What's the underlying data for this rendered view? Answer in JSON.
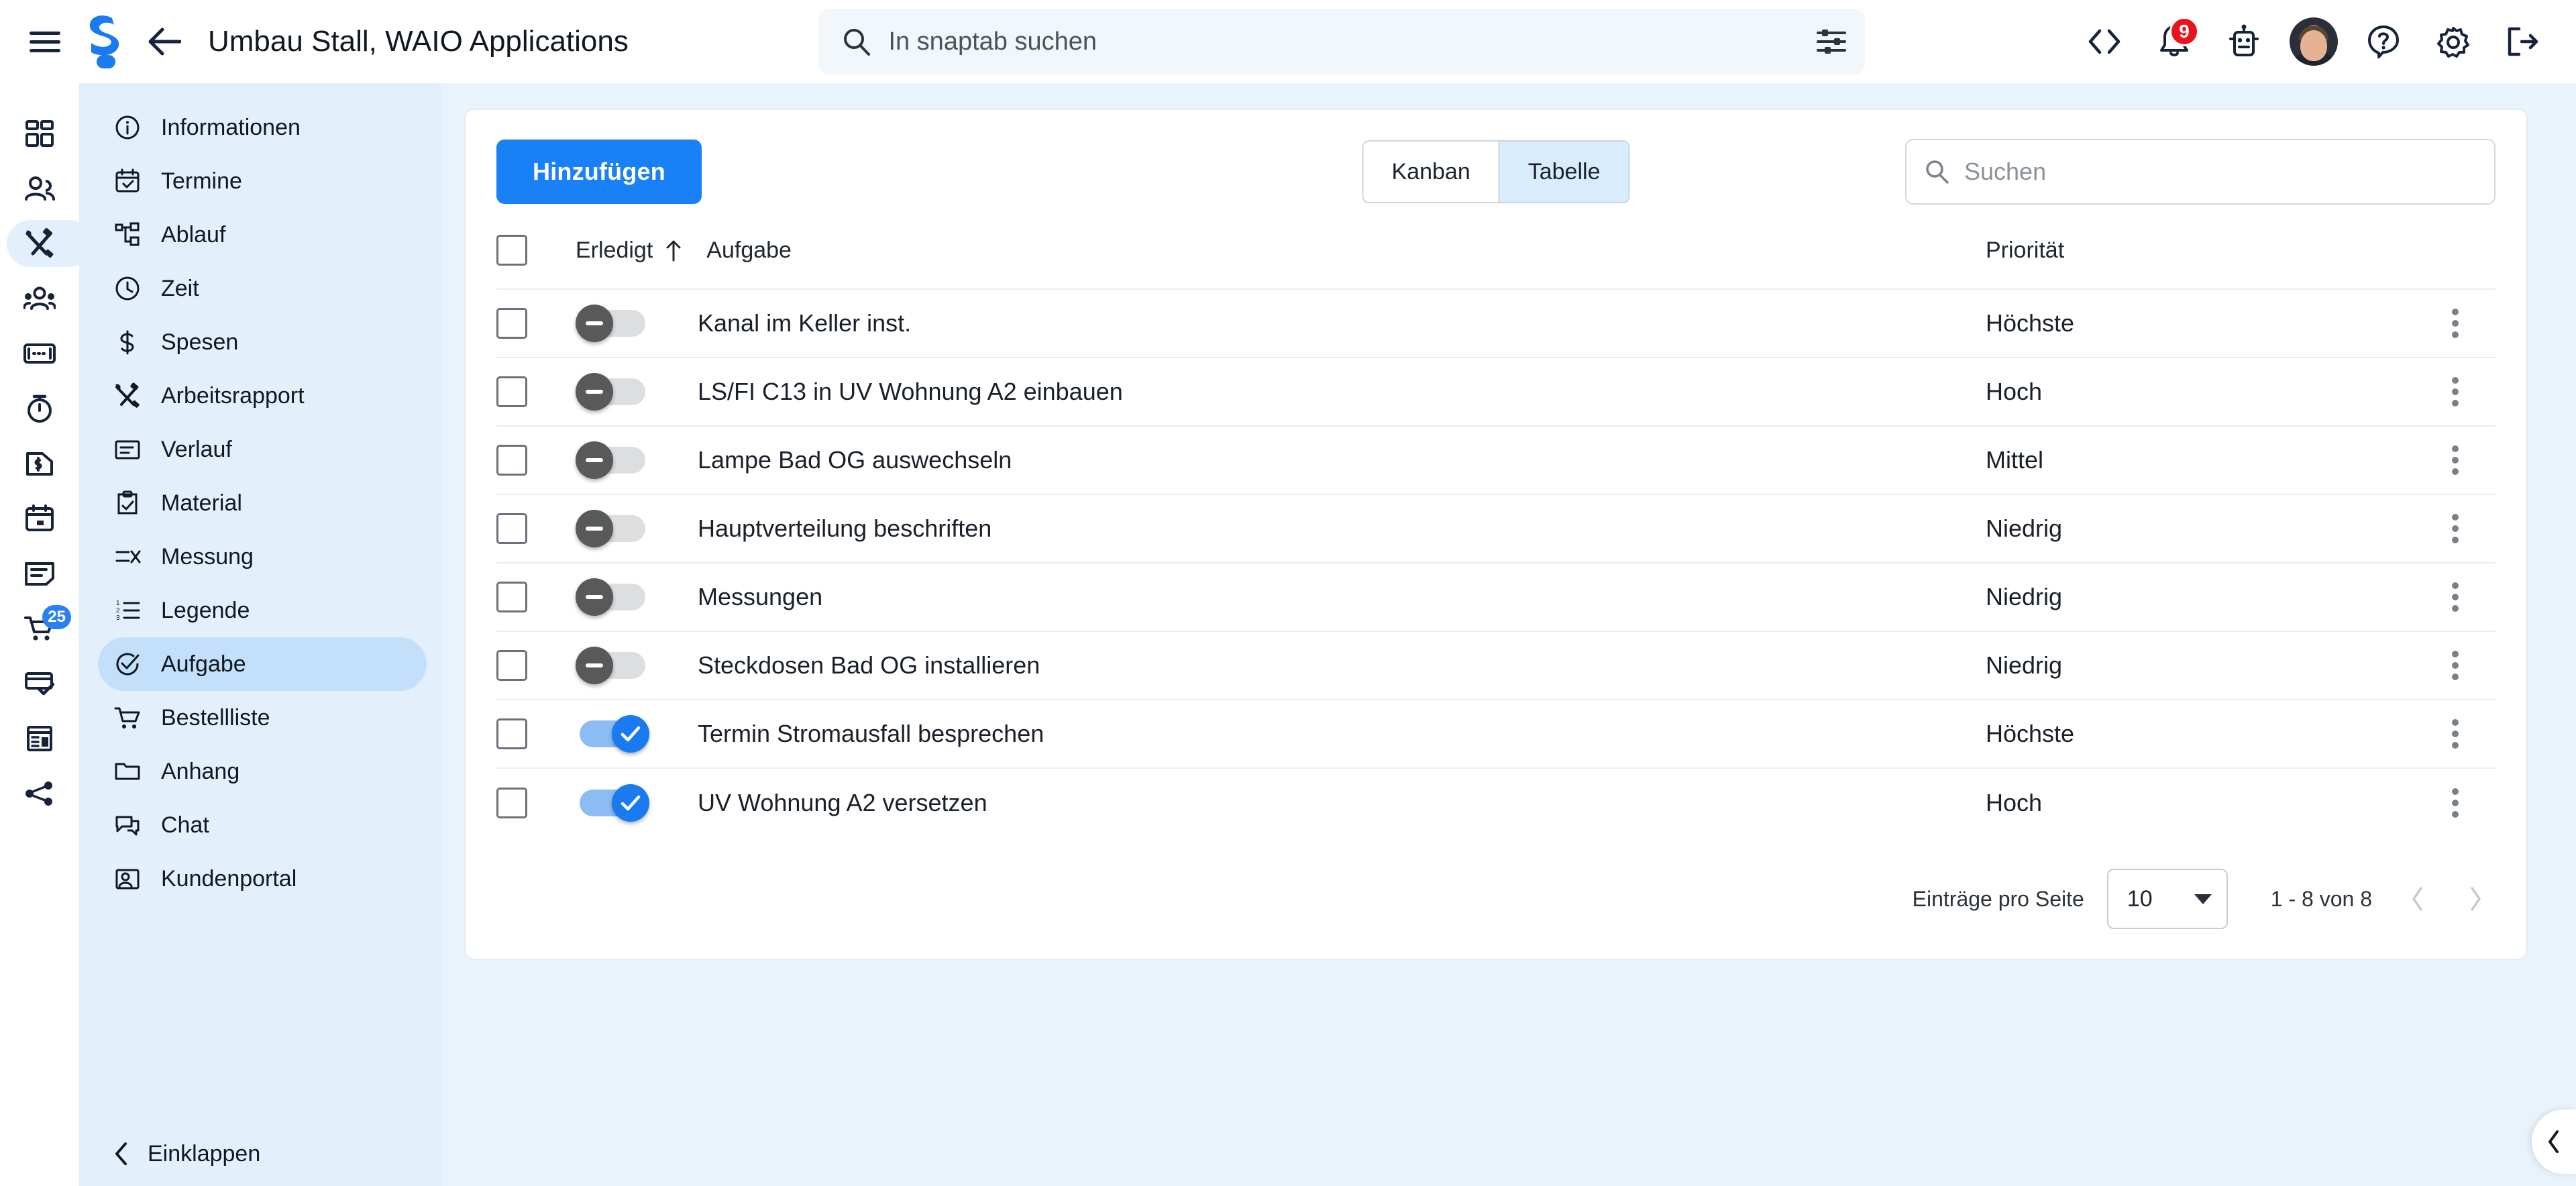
{
  "topbar": {
    "menu_icon": "hamburger-menu-icon",
    "logo_icon": "snaptab-logo-icon",
    "back_icon": "arrow-left-icon",
    "title": "Umbau Stall, WAIO Applications",
    "search": {
      "placeholder": "In snaptab suchen",
      "value": "",
      "search_icon": "search-icon",
      "filter_icon": "tune-filter-icon"
    },
    "actions": [
      {
        "name": "code-brackets-icon",
        "label": ""
      },
      {
        "name": "notification-bell-icon",
        "label": "",
        "badge": "9"
      },
      {
        "name": "robot-assistant-icon",
        "label": ""
      },
      {
        "name": "user-avatar",
        "label": ""
      },
      {
        "name": "help-question-icon",
        "label": ""
      },
      {
        "name": "settings-gear-icon",
        "label": ""
      },
      {
        "name": "logout-icon",
        "label": ""
      }
    ],
    "badge_count": "9"
  },
  "rail": {
    "items": [
      {
        "name": "dashboard-grid-icon",
        "active": false
      },
      {
        "name": "contacts-people-icon",
        "active": false
      },
      {
        "name": "tools-wrench-hammer-icon",
        "active": true
      },
      {
        "name": "team-group-icon",
        "active": false
      },
      {
        "name": "card-id-icon",
        "active": false
      },
      {
        "name": "stopwatch-icon",
        "active": false
      },
      {
        "name": "invoice-money-icon",
        "active": false
      },
      {
        "name": "calendar-icon",
        "active": false
      },
      {
        "name": "note-document-icon",
        "active": false
      },
      {
        "name": "shopping-cart-icon",
        "active": false,
        "badge": "25"
      },
      {
        "name": "card-check-icon",
        "active": false
      },
      {
        "name": "receipt-building-icon",
        "active": false
      },
      {
        "name": "share-network-icon",
        "active": false
      }
    ]
  },
  "sidebar": {
    "items": [
      {
        "label": "Informationen",
        "icon": "info-circle-icon",
        "active": false
      },
      {
        "label": "Termine",
        "icon": "calendar-check-icon",
        "active": false
      },
      {
        "label": "Ablauf",
        "icon": "workflow-tree-icon",
        "active": false
      },
      {
        "label": "Zeit",
        "icon": "clock-icon",
        "active": false
      },
      {
        "label": "Spesen",
        "icon": "dollar-sign-icon",
        "active": false
      },
      {
        "label": "Arbeitsrapport",
        "icon": "tools-wrench-hammer-icon",
        "active": false
      },
      {
        "label": "Verlauf",
        "icon": "history-card-icon",
        "active": false
      },
      {
        "label": "Material",
        "icon": "clipboard-check-icon",
        "active": false
      },
      {
        "label": "Messung",
        "icon": "measure-lines-icon",
        "active": false
      },
      {
        "label": "Legende",
        "icon": "numbered-list-icon",
        "active": false
      },
      {
        "label": "Aufgabe",
        "icon": "task-check-circle-icon",
        "active": true
      },
      {
        "label": "Bestellliste",
        "icon": "shopping-cart-icon",
        "active": false
      },
      {
        "label": "Anhang",
        "icon": "folder-icon",
        "active": false
      },
      {
        "label": "Chat",
        "icon": "chat-bubble-icon",
        "active": false
      },
      {
        "label": "Kundenportal",
        "icon": "customer-portal-icon",
        "active": false
      }
    ],
    "collapse": {
      "label": "Einklappen",
      "icon": "chevron-left-icon"
    }
  },
  "main": {
    "add_button": "Hinzufügen",
    "view_tabs": [
      {
        "label": "Kanban",
        "active": false
      },
      {
        "label": "Tabelle",
        "active": true
      }
    ],
    "search": {
      "placeholder": "Suchen",
      "value": "",
      "icon": "search-icon"
    },
    "table": {
      "columns": [
        {
          "key": "check",
          "label": ""
        },
        {
          "key": "done",
          "label": "Erledigt",
          "sort": "asc",
          "sort_icon": "arrow-up-icon"
        },
        {
          "key": "task",
          "label": "Aufgabe"
        },
        {
          "key": "priority",
          "label": "Priorität"
        },
        {
          "key": "menu",
          "label": ""
        }
      ],
      "rows": [
        {
          "selected": false,
          "done": false,
          "task": "Kanal im Keller inst.",
          "priority": "Höchste"
        },
        {
          "selected": false,
          "done": false,
          "task": "LS/FI C13 in UV Wohnung A2 einbauen",
          "priority": "Hoch"
        },
        {
          "selected": false,
          "done": false,
          "task": "Lampe Bad OG auswechseln",
          "priority": "Mittel"
        },
        {
          "selected": false,
          "done": false,
          "task": "Hauptverteilung beschriften",
          "priority": "Niedrig"
        },
        {
          "selected": false,
          "done": false,
          "task": "Messungen",
          "priority": "Niedrig"
        },
        {
          "selected": false,
          "done": false,
          "task": "Steckdosen Bad OG installieren",
          "priority": "Niedrig"
        },
        {
          "selected": false,
          "done": true,
          "task": "Termin Stromausfall besprechen",
          "priority": "Höchste"
        },
        {
          "selected": false,
          "done": true,
          "task": "UV Wohnung A2 versetzen",
          "priority": "Hoch"
        }
      ],
      "row_menu_icon": "kebab-menu-icon"
    },
    "pagination": {
      "per_page_label": "Einträge pro Seite",
      "per_page_value": "10",
      "range_label": "1 - 8 von 8",
      "prev_icon": "chevron-left-icon",
      "next_icon": "chevron-right-icon"
    }
  },
  "float_tab": {
    "icon": "chevron-left-icon"
  },
  "colors": {
    "accent_blue": "#1a80f5",
    "page_bg": "#e8f3fc",
    "sidebar_bg": "#e3f0fc",
    "sidebar_active": "#c3dffa",
    "badge_red": "#e8131c",
    "toggle_off": "#58595b",
    "toggle_on": "#1a7bf0"
  }
}
